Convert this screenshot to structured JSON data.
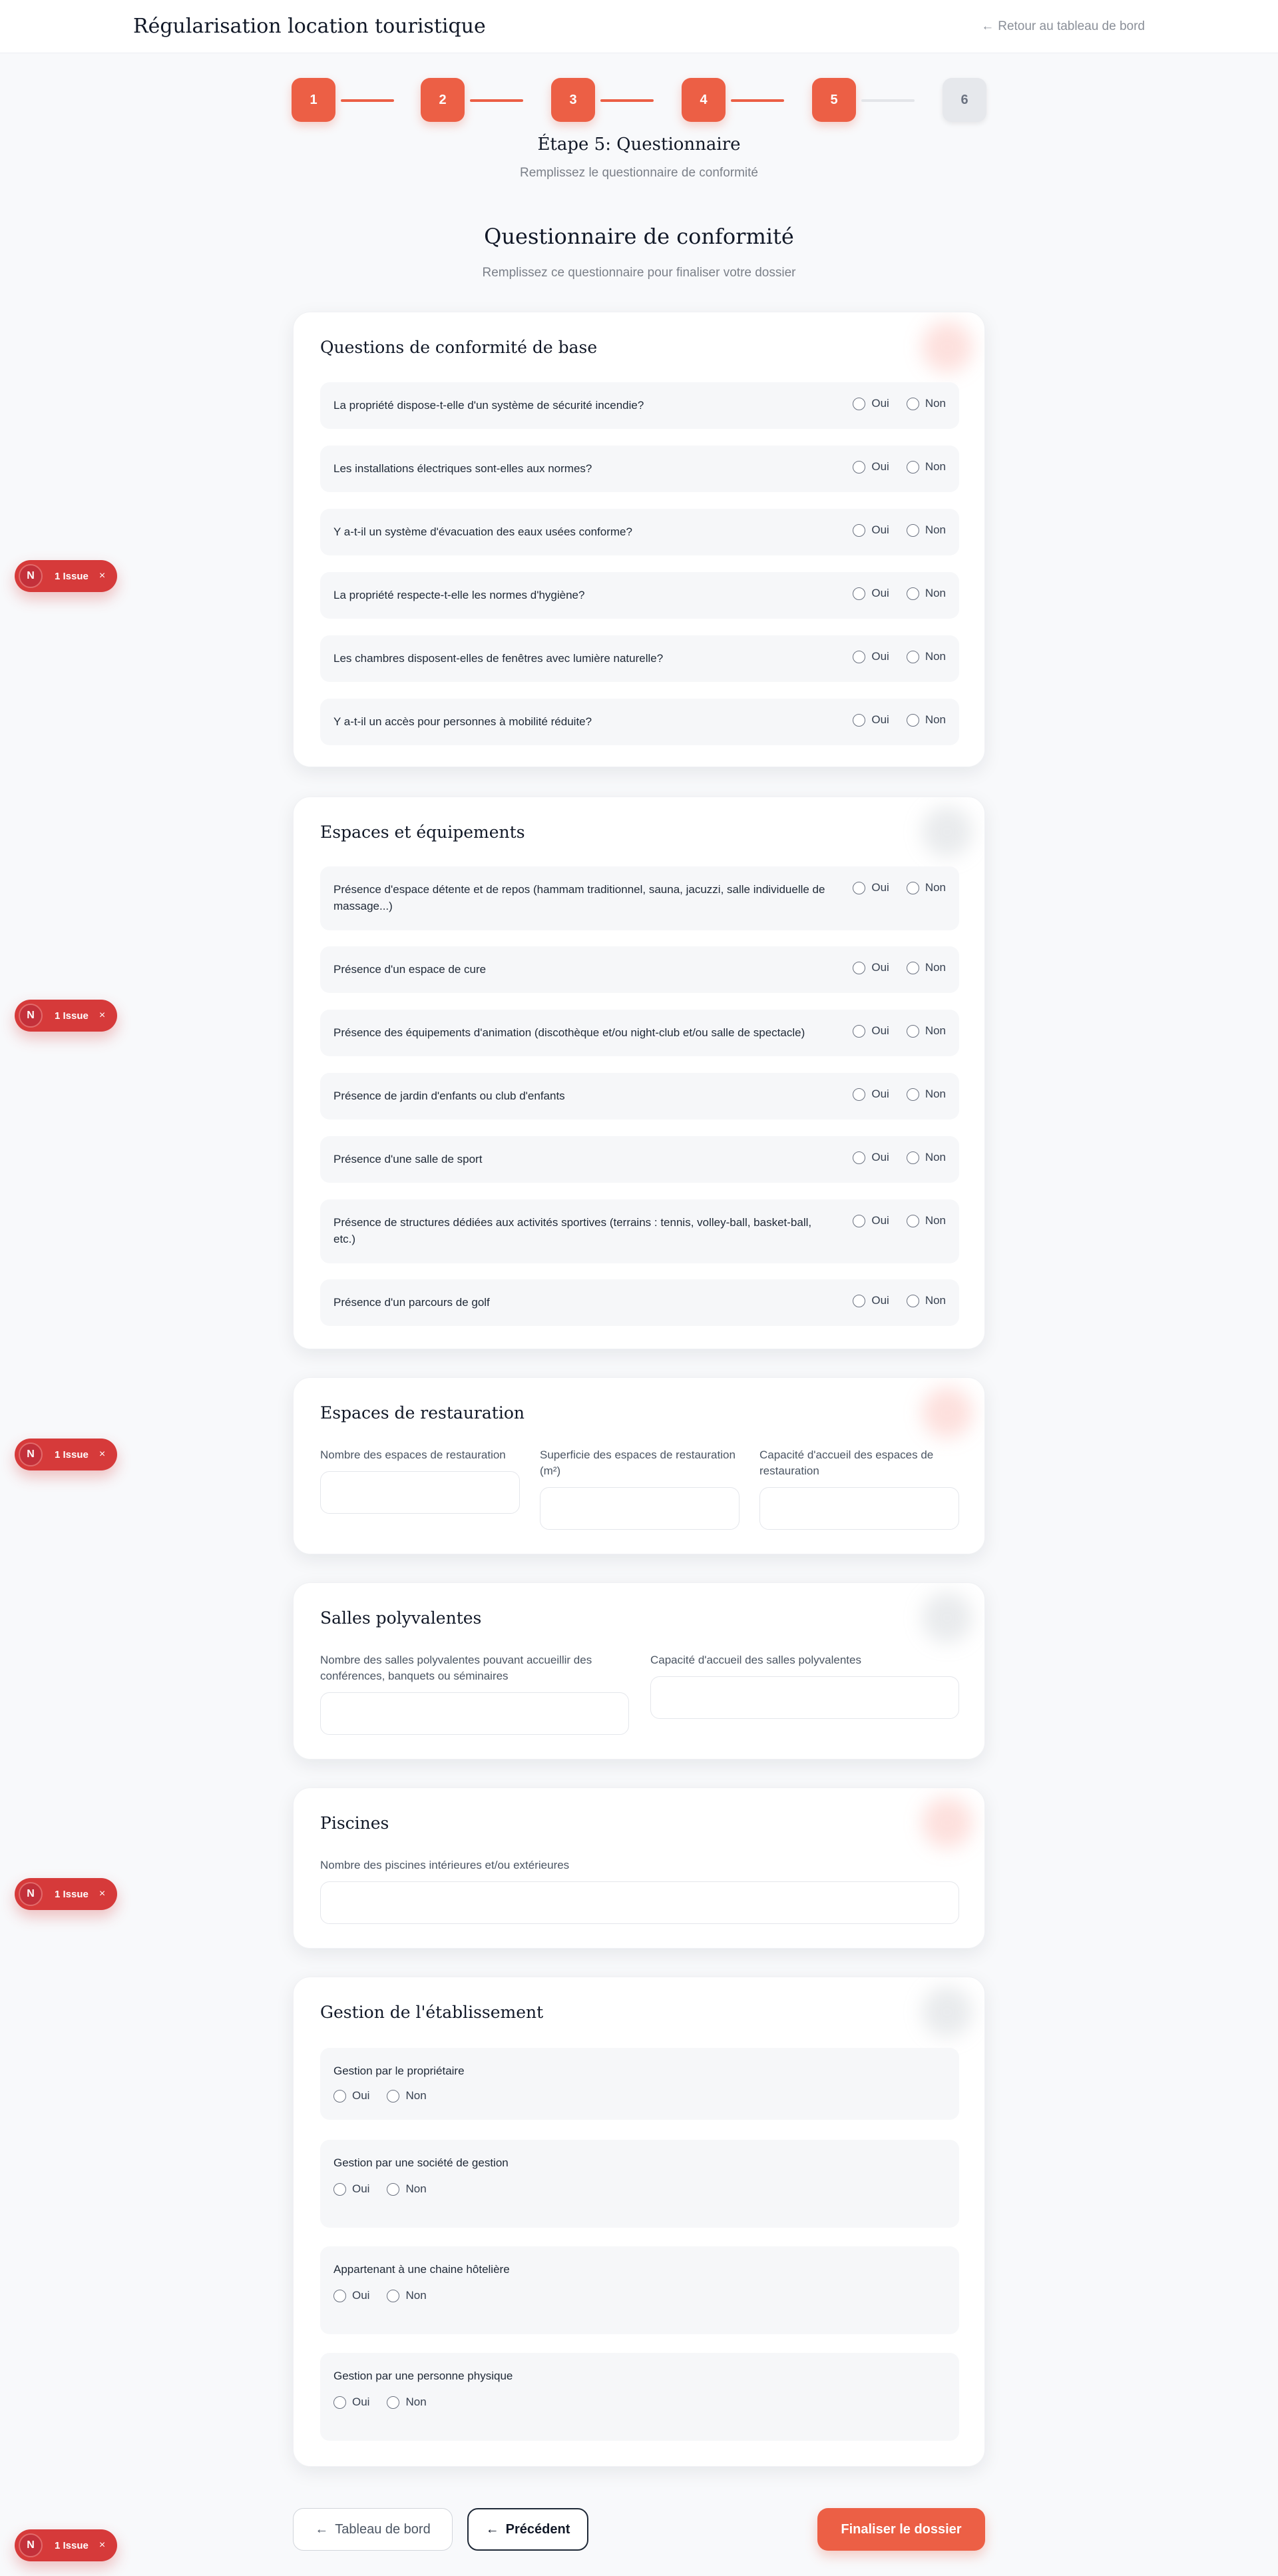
{
  "header": {
    "app_title": "Régularisation location touristique",
    "back_arrow": "←",
    "back_link": "Retour au tableau de bord"
  },
  "stepper": {
    "steps": [
      "1",
      "2",
      "3",
      "4",
      "5",
      "6"
    ],
    "current_step": 5,
    "accent_color": "#ec5f45"
  },
  "step": {
    "title": "Étape 5: Questionnaire",
    "subtitle": "Remplissez le questionnaire de conformité"
  },
  "questionnaire": {
    "title": "Questionnaire de conformité",
    "subtitle": "Remplissez ce questionnaire pour finaliser votre dossier"
  },
  "radio": {
    "yes": "Oui",
    "no": "Non"
  },
  "sections": {
    "base": {
      "title": "Questions de conformité de base",
      "questions": [
        "La propriété dispose-t-elle d'un système de sécurité incendie?",
        "Les installations électriques sont-elles aux normes?",
        "Y a-t-il un système d'évacuation des eaux usées conforme?",
        "La propriété respecte-t-elle les normes d'hygiène?",
        "Les chambres disposent-elles de fenêtres avec lumière naturelle?",
        "Y a-t-il un accès pour personnes à mobilité réduite?"
      ]
    },
    "espaces": {
      "title": "Espaces et équipements",
      "questions": [
        "Présence d'espace détente et de repos (hammam traditionnel, sauna, jacuzzi, salle individuelle de massage...)",
        "Présence d'un espace de cure",
        "Présence des équipements d'animation (discothèque et/ou night-club et/ou salle de spectacle)",
        "Présence de jardin d'enfants ou club d'enfants",
        "Présence d'une salle de sport",
        "Présence de structures dédiées aux activités sportives (terrains : tennis, volley-ball, basket-ball, etc.)",
        "Présence d'un parcours de golf"
      ]
    },
    "restauration": {
      "title": "Espaces de restauration",
      "fields": [
        {
          "label": "Nombre des espaces de restauration",
          "value": ""
        },
        {
          "label": "Superficie des espaces de restauration (m²)",
          "value": ""
        },
        {
          "label": "Capacité d'accueil des espaces de restauration",
          "value": ""
        }
      ]
    },
    "salles": {
      "title": "Salles polyvalentes",
      "fields": [
        {
          "label": "Nombre des salles polyvalentes pouvant accueillir des conférences, banquets ou séminaires",
          "value": ""
        },
        {
          "label": "Capacité d'accueil des salles polyvalentes",
          "value": ""
        }
      ]
    },
    "piscines": {
      "title": "Piscines",
      "fields": [
        {
          "label": "Nombre des piscines intérieures et/ou extérieures",
          "value": ""
        }
      ]
    },
    "gestion": {
      "title": "Gestion de l'établissement",
      "questions": [
        "Gestion par le propriétaire",
        "Gestion par une société de gestion",
        "Appartenant à une chaine hôtelière",
        "Gestion par une personne physique"
      ]
    }
  },
  "issue_badge": {
    "logo": "N",
    "label": "1 Issue",
    "close": "×",
    "color": "#d63a3a"
  },
  "footer": {
    "dashboard_button": "Tableau de bord",
    "previous_button": "Précédent",
    "finalize_button": "Finaliser le dossier",
    "arrow": "←"
  }
}
